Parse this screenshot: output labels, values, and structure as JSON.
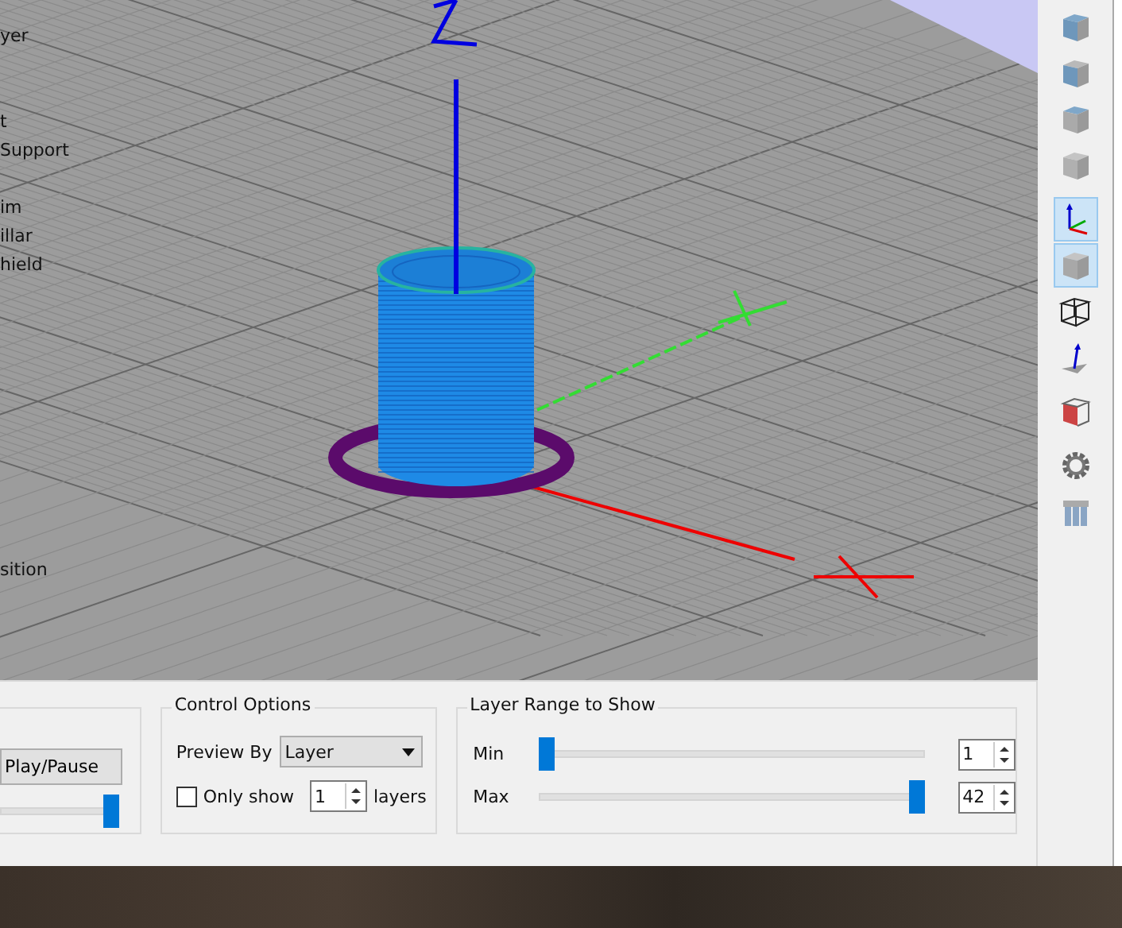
{
  "viewport": {
    "legend": [
      "yer",
      "t",
      "Support",
      "im",
      "illar",
      "hield",
      "sition"
    ]
  },
  "toolbar": [
    {
      "kind": "cube-top",
      "selected": false
    },
    {
      "kind": "cube-front",
      "selected": false
    },
    {
      "kind": "cube-side",
      "selected": false
    },
    {
      "kind": "cube-iso",
      "selected": false
    },
    {
      "kind": "axes",
      "selected": true
    },
    {
      "kind": "solid",
      "selected": true
    },
    {
      "kind": "wireframe",
      "selected": false
    },
    {
      "kind": "normal",
      "selected": false
    },
    {
      "kind": "section",
      "selected": false
    },
    {
      "kind": "gear",
      "selected": false
    },
    {
      "kind": "columns",
      "selected": false
    }
  ],
  "animation": {
    "button": "Play/Pause",
    "speed": {
      "level": 1
    }
  },
  "control_options": {
    "title": "Control Options",
    "preview_by": {
      "label": "Preview By",
      "value": "Layer"
    },
    "only_show": {
      "label": "Only show",
      "checked": false,
      "value": "1",
      "suffix": "layers"
    }
  },
  "layer_range": {
    "title": "Layer Range to Show",
    "min": {
      "label": "Min",
      "level": 0,
      "value": "1"
    },
    "max": {
      "label": "Max",
      "level": 1,
      "value": "42"
    }
  }
}
